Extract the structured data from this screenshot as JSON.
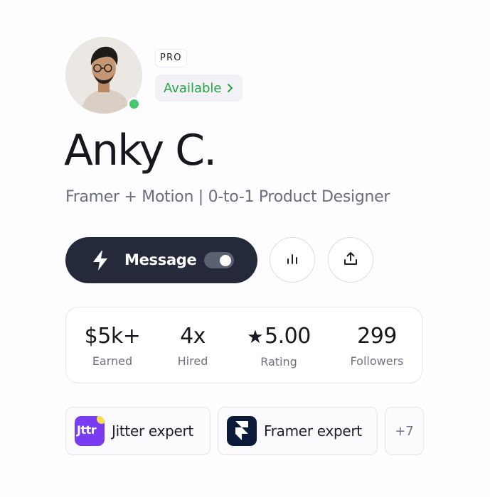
{
  "profile": {
    "badge": "PRO",
    "availability": "Available",
    "name": "Anky C.",
    "headline": "Framer + Motion | 0-to-1 Product Designer",
    "online": true
  },
  "actions": {
    "message_label": "Message",
    "message_toggle_on": true,
    "stats_icon": "bar-chart-icon",
    "share_icon": "share-icon",
    "message_icon": "bolt-icon"
  },
  "stats": [
    {
      "value": "$5k+",
      "label": "Earned"
    },
    {
      "value": "4x",
      "label": "Hired"
    },
    {
      "value": "5.00",
      "label": "Rating",
      "icon": "star-icon"
    },
    {
      "value": "299",
      "label": "Followers"
    }
  ],
  "skills": [
    {
      "label": "Jitter expert",
      "logo": "jitter-logo",
      "logo_text": "Jttr"
    },
    {
      "label": "Framer expert",
      "logo": "framer-logo"
    }
  ],
  "skills_more": "+7",
  "colors": {
    "available_green": "#27a447",
    "online_dot": "#49c86f",
    "message_bg": "#252a3a",
    "jitter_purple": "#7a3cf2",
    "framer_navy": "#0c1a3a"
  }
}
